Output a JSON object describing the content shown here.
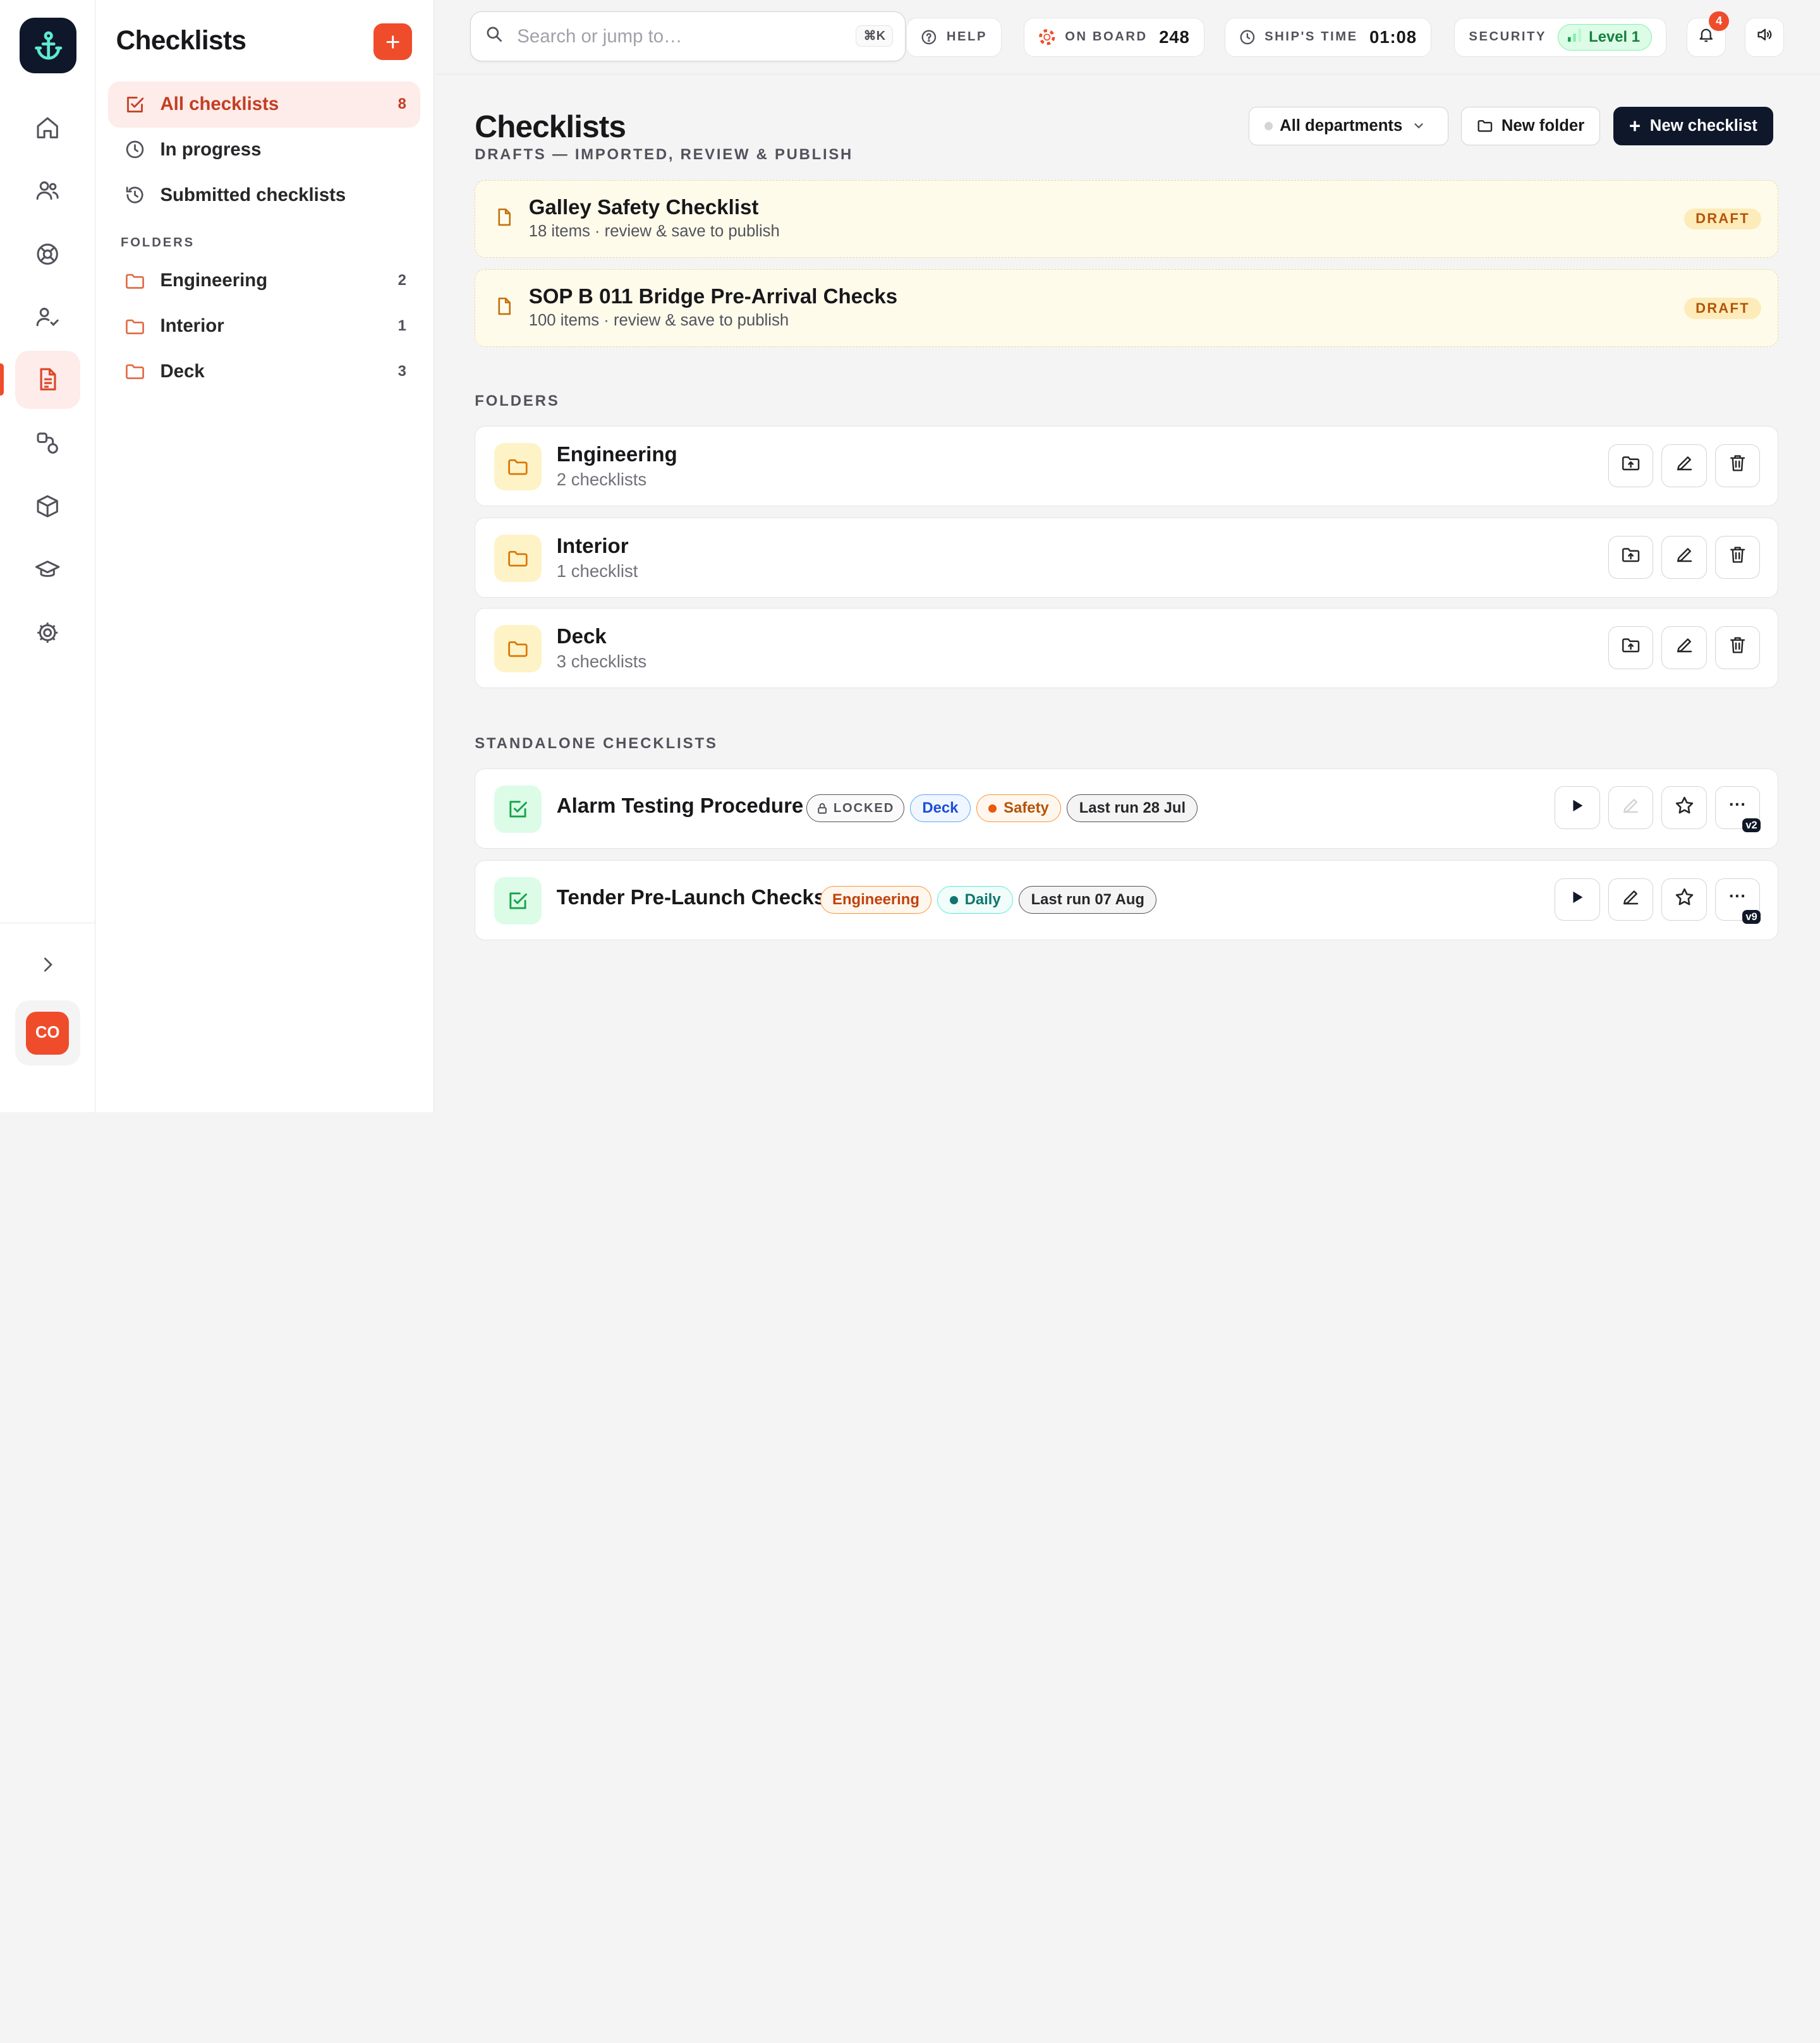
{
  "app": {
    "avatar_initials": "CO"
  },
  "sidebar": {
    "title": "Checklists",
    "nav": [
      {
        "label": "All checklists",
        "count": "8"
      },
      {
        "label": "In progress",
        "count": ""
      },
      {
        "label": "Submitted checklists",
        "count": ""
      }
    ],
    "folders_label": "FOLDERS",
    "folders": [
      {
        "label": "Engineering",
        "count": "2"
      },
      {
        "label": "Interior",
        "count": "1"
      },
      {
        "label": "Deck",
        "count": "3"
      }
    ]
  },
  "topbar": {
    "search_placeholder": "Search or jump to…",
    "search_shortcut": "⌘K",
    "help_label": "HELP",
    "on_board_label": "ON BOARD",
    "on_board_value": "248",
    "ships_time_label": "SHIP'S TIME",
    "ships_time_value": "01:08",
    "security_label": "SECURITY",
    "security_level": "Level 1",
    "notifications_count": "4"
  },
  "page": {
    "title": "Checklists",
    "subtitle": "DRAFTS — IMPORTED, REVIEW & PUBLISH",
    "department_filter": "All departments",
    "new_folder_label": "New folder",
    "new_checklist_label": "New checklist"
  },
  "drafts": [
    {
      "title": "Galley Safety Checklist",
      "subtitle": "18 items · review & save to publish",
      "badge": "DRAFT"
    },
    {
      "title": "SOP B 011 Bridge Pre-Arrival Checks",
      "subtitle": "100 items · review & save to publish",
      "badge": "DRAFT"
    }
  ],
  "folders_section": {
    "label": "FOLDERS",
    "items": [
      {
        "title": "Engineering",
        "subtitle": "2 checklists"
      },
      {
        "title": "Interior",
        "subtitle": "1 checklist"
      },
      {
        "title": "Deck",
        "subtitle": "3 checklists"
      }
    ]
  },
  "standalone_section": {
    "label": "STANDALONE CHECKLISTS",
    "items": [
      {
        "title": "Alarm Testing Procedure",
        "locked": "LOCKED",
        "tag1": "Deck",
        "tag2": "Safety",
        "last_run": "Last run 28 Jul",
        "version": "v2"
      },
      {
        "title": "Tender Pre-Launch Checks",
        "tag1": "Engineering",
        "tag2": "Daily",
        "last_run": "Last run 07 Aug",
        "version": "v9"
      }
    ]
  },
  "colors": {
    "accent": "#ef4c2c",
    "dark": "#0f172a",
    "draft_bg": "#fffbeb",
    "success": "#16a34a"
  }
}
